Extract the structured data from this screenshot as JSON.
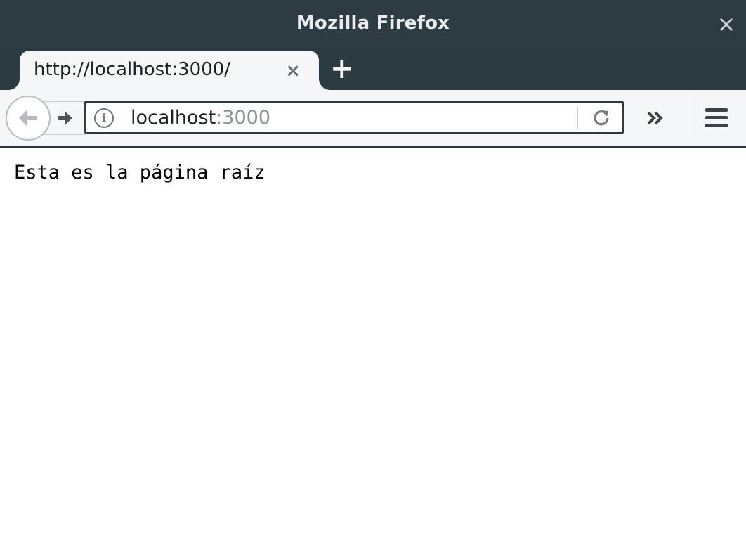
{
  "window": {
    "title": "Mozilla Firefox",
    "close_label": "×"
  },
  "tabs": [
    {
      "label": "http://localhost:3000/",
      "close_label": "×",
      "active": true
    }
  ],
  "new_tab_label": "+",
  "navigation": {
    "url_host": "localhost",
    "url_port": ":3000"
  },
  "icons": {
    "back": "back-arrow-icon",
    "forward": "forward-arrow-icon",
    "info": "info-icon",
    "reload": "reload-icon",
    "overflow": "chevron-double-right-icon",
    "menu": "hamburger-menu-icon"
  },
  "page": {
    "text": "Esta es la página raíz"
  },
  "colors": {
    "chrome_dark": "#2f3b43",
    "toolbar_bg": "#f5f6f7",
    "page_bg": "#ffffff"
  }
}
